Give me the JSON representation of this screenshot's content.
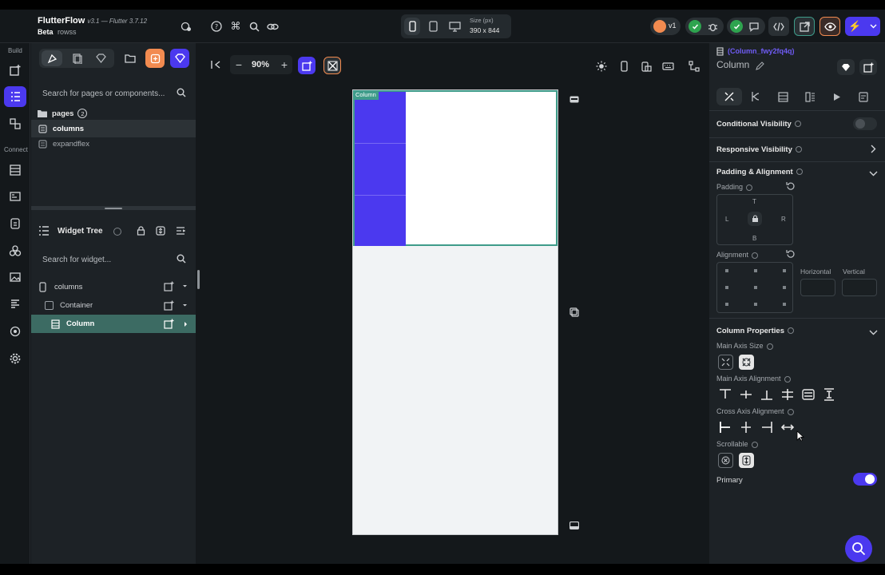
{
  "app": {
    "name": "FlutterFlow",
    "version": "v3.1 — Flutter 3.7.12",
    "channel": "Beta",
    "project": "rowss"
  },
  "rail": {
    "build_label": "Build",
    "connect_label": "Connect"
  },
  "device": {
    "size_label": "Size (px)",
    "size_value": "390 x 844"
  },
  "topbar": {
    "version_badge": "v1"
  },
  "canvas_toolbar": {
    "zoom": "90%",
    "zoom_out": "−",
    "zoom_in": "+"
  },
  "pages_panel": {
    "search_placeholder": "Search for pages or components...",
    "folder_label": "pages",
    "folder_count": "2",
    "items": [
      {
        "label": "columns",
        "selected": true
      },
      {
        "label": "expandflex",
        "selected": false
      }
    ]
  },
  "widget_tree": {
    "title": "Widget Tree",
    "search_placeholder": "Search for widget...",
    "nodes": [
      {
        "label": "columns"
      },
      {
        "label": "Container"
      },
      {
        "label": "Column"
      }
    ]
  },
  "canvas": {
    "selected_tag": "Column"
  },
  "properties": {
    "widget_id": "(Column_fwy2fq4q)",
    "widget_name": "Column",
    "conditional_visibility": "Conditional Visibility",
    "responsive_visibility": "Responsive Visibility",
    "padding_alignment": "Padding & Alignment",
    "padding_label": "Padding",
    "pad_t": "T",
    "pad_l": "L",
    "pad_r": "R",
    "pad_b": "B",
    "alignment_label": "Alignment",
    "horizontal_label": "Horizontal",
    "vertical_label": "Vertical",
    "column_properties": "Column Properties",
    "main_axis_size": "Main Axis Size",
    "main_axis_alignment": "Main Axis Alignment",
    "cross_axis_alignment": "Cross Axis Alignment",
    "scrollable": "Scrollable",
    "primary": "Primary",
    "primary_on": true
  },
  "colors": {
    "accent": "#4b39ef",
    "teal": "#3e9c8a",
    "green": "#2ea44f",
    "orange": "#f28b50"
  }
}
